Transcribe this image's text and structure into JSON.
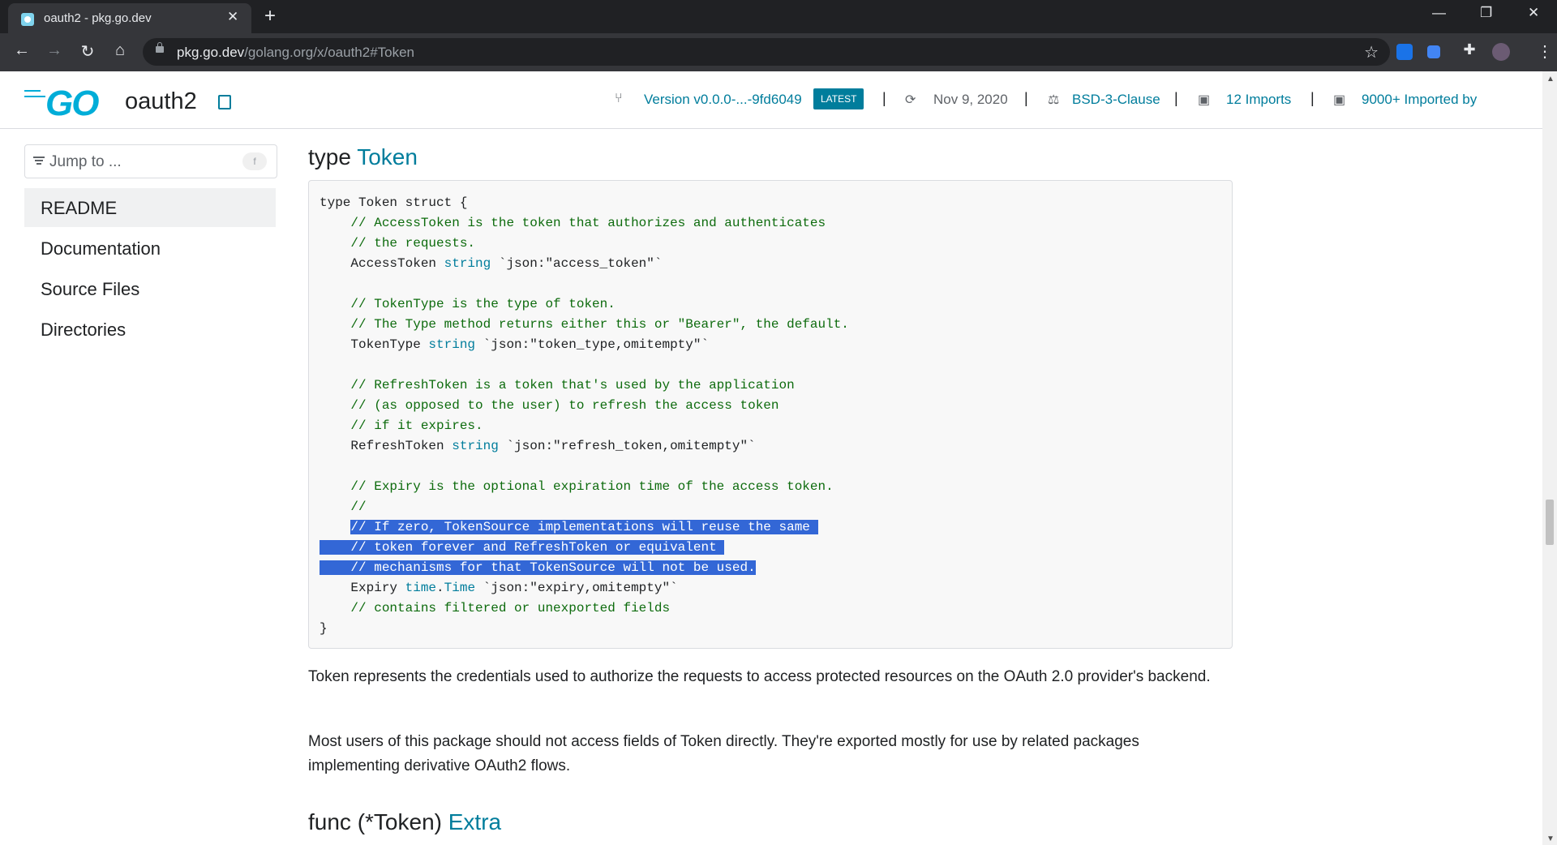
{
  "browser": {
    "tab_title": "oauth2 - pkg.go.dev",
    "tab_close": "✕",
    "new_tab": "+",
    "url_host": "pkg.go.dev",
    "url_path": "/golang.org/x/oauth2#Token",
    "window_controls": [
      "—",
      "❐",
      "✕"
    ]
  },
  "header": {
    "logo_text": "GO",
    "package_name": "oauth2",
    "version": "Version v0.0.0-...-9fd6049",
    "latest_badge": "LATEST",
    "date": "Nov 9, 2020",
    "license": "BSD-3-Clause",
    "imports": "12 Imports",
    "imported_by": "9000+ Imported by",
    "separator": "|"
  },
  "sidebar": {
    "jump_placeholder": "Jump to ...",
    "jump_shortcut": "f",
    "items": [
      {
        "label": "README",
        "active": true
      },
      {
        "label": "Documentation"
      },
      {
        "label": "Source Files"
      },
      {
        "label": "Directories"
      }
    ]
  },
  "main": {
    "type_keyword": "type",
    "type_name": "Token",
    "code": {
      "line1": "type Token struct {",
      "c1": "    // AccessToken is the token that authorizes and authenticates",
      "c2": "    // the requests.",
      "f1_name": "    AccessToken ",
      "f1_type": "string",
      "f1_tag": " `json:\"access_token\"`",
      "c3": "    // TokenType is the type of token.",
      "c4": "    // The Type method returns either this or \"Bearer\", the default.",
      "f2_name": "    TokenType ",
      "f2_type": "string",
      "f2_tag": " `json:\"token_type,omitempty\"`",
      "c5": "    // RefreshToken is a token that's used by the application",
      "c6": "    // (as opposed to the user) to refresh the access token",
      "c7": "    // if it expires.",
      "f3_name": "    RefreshToken ",
      "f3_type": "string",
      "f3_tag": " `json:\"refresh_token,omitempty\"`",
      "c8": "    // Expiry is the optional expiration time of the access token.",
      "c9": "    //",
      "sel_indent": "    ",
      "sel1": "// If zero, TokenSource implementations will reuse the same ",
      "sel2": "    // token forever and RefreshToken or equivalent ",
      "sel3": "    // mechanisms for that TokenSource will not be used.",
      "f4_name": "    Expiry ",
      "f4_pkg": "time",
      "f4_dot": ".",
      "f4_type": "Time",
      "f4_tag": " `json:\"expiry,omitempty\"`",
      "c10": "    // contains filtered or unexported fields",
      "close": "}"
    },
    "para1": "Token represents the credentials used to authorize the requests to access protected resources on the OAuth 2.0 provider's backend.",
    "para2": "Most users of this package should not access fields of Token directly. They're exported mostly for use by related packages implementing derivative OAuth2 flows.",
    "func_prefix": "func (*Token) ",
    "func_name": "Extra"
  }
}
